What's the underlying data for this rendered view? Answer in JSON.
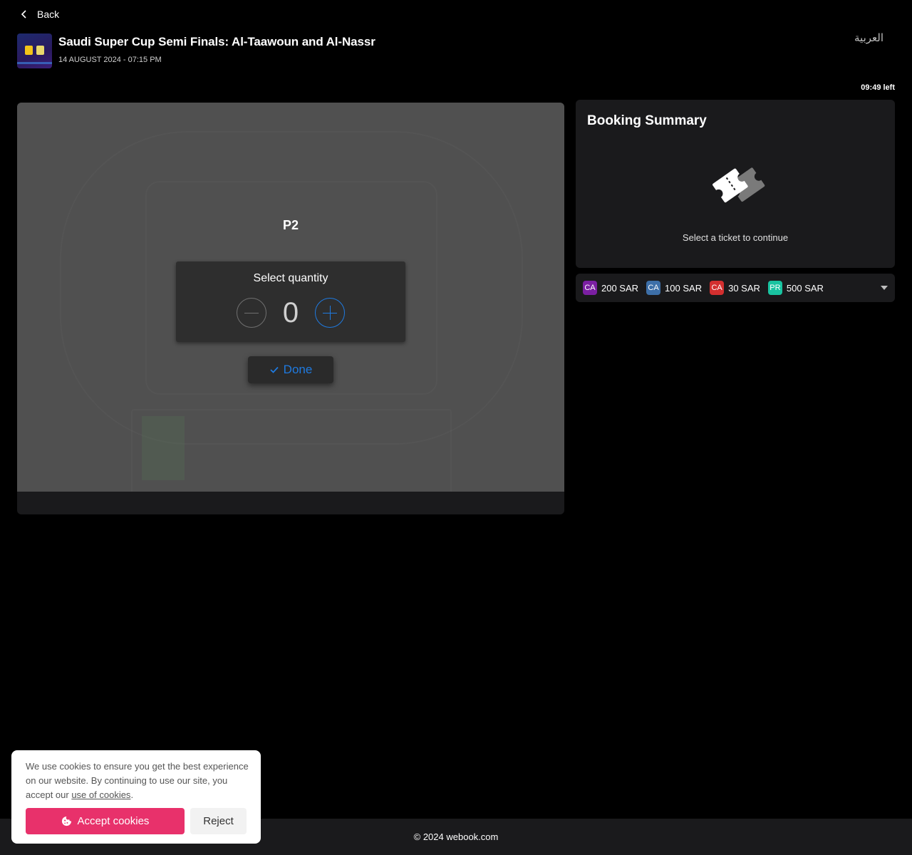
{
  "nav": {
    "back_label": "Back"
  },
  "event": {
    "title": "Saudi Super Cup Semi Finals: Al-Taawoun and Al-Nassr",
    "date": "14 AUGUST 2024 - 07:15 PM"
  },
  "language": {
    "label": "العربية"
  },
  "timer": {
    "label": "09:49 left"
  },
  "seat_map": {
    "section_label": "P2",
    "quantity_popup": {
      "title": "Select quantity",
      "value": "0",
      "done_label": "Done"
    }
  },
  "summary": {
    "title": "Booking Summary",
    "empty_text": "Select a ticket to continue"
  },
  "price_legend": [
    {
      "code": "CA",
      "price": "200 SAR",
      "color": "#7b1fa2"
    },
    {
      "code": "CA",
      "price": "100 SAR",
      "color": "#3d6fa8"
    },
    {
      "code": "CA",
      "price": "30 SAR",
      "color": "#d32f2f"
    },
    {
      "code": "PR",
      "price": "500 SAR",
      "color": "#19c3a0"
    }
  ],
  "footer": {
    "copyright": "© 2024 webook.com"
  },
  "cookie_banner": {
    "text_before": "We use cookies to ensure you get the best experience on our website. By continuing to use our site, you accept our ",
    "link_text": "use of cookies",
    "text_after": ".",
    "accept_label": "Accept cookies",
    "reject_label": "Reject"
  },
  "colors": {
    "accent_blue": "#1f7ae0",
    "accept_pink": "#e8316b",
    "panel_bg": "#1a1a1c",
    "map_bg": "#505050"
  }
}
